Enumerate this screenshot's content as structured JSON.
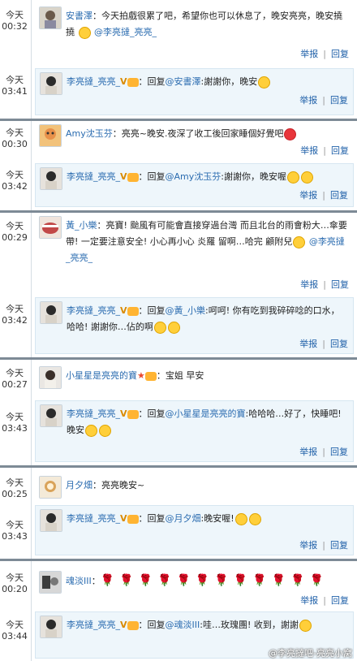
{
  "actions": {
    "report": "举报",
    "reply": "回复"
  },
  "threads": [
    {
      "post": {
        "day": "今天",
        "time": "00:32",
        "user": "安書澤",
        "text": "：今天拍戲很累了吧，希望你也可以休息了，晚安亮亮，晚安撓撓",
        "mention": "@李亮撻_亮亮_"
      },
      "reply": {
        "day": "今天",
        "time": "03:41",
        "user": "李亮撻_亮亮_",
        "prefix": "：回复",
        "mention": "@安書澤",
        "text": ":謝謝你，晚安"
      }
    },
    {
      "post": {
        "day": "今天",
        "time": "00:30",
        "user": "Amy沈玉芬",
        "text": "：亮亮~晚安.夜深了收工後回家睡個好覺吧"
      },
      "reply": {
        "day": "今天",
        "time": "03:42",
        "user": "李亮撻_亮亮_",
        "prefix": "：回复",
        "mention": "@Amy沈玉芬",
        "text": ":謝謝你，晚安喔"
      }
    },
    {
      "post": {
        "day": "今天",
        "time": "00:29",
        "user": "黃_小樂",
        "text": "：亮寶! 颱風有可能會直接穿過台灣  而且北台的雨會粉大…傘要帶! 一定要注意安全! 小心再小心  炎羅  留啊…哈完 顧附兒",
        "mention": "@李亮撻_亮亮_"
      },
      "reply": {
        "day": "今天",
        "time": "03:42",
        "user": "李亮撻_亮亮_",
        "prefix": "：回复",
        "mention": "@黃_小樂",
        "text": ":呵呵! 你有吃到我碎碎唸的口水，哈哈! 謝謝你…佔的啊"
      }
    },
    {
      "post": {
        "day": "今天",
        "time": "00:27",
        "user": "小星星是亮亮的寶",
        "text": "：宝姐 早安"
      },
      "reply": {
        "day": "今天",
        "time": "03:43",
        "user": "李亮撻_亮亮_",
        "prefix": "：回复",
        "mention": "@小星星是亮亮的寶",
        "text": ":哈哈哈…好了，快睡吧! 晚安"
      }
    },
    {
      "post": {
        "day": "今天",
        "time": "00:25",
        "user": "月夕畑",
        "text": "：亮亮晚安~"
      },
      "reply": {
        "day": "今天",
        "time": "03:43",
        "user": "李亮撻_亮亮_",
        "prefix": "：回复",
        "mention": "@月夕畑",
        "text": ":晚安喔!"
      }
    },
    {
      "post": {
        "day": "今天",
        "time": "00:20",
        "user": "魂淡III",
        "text": "："
      },
      "reply": {
        "day": "今天",
        "time": "03:44",
        "user": "李亮撻_亮亮_",
        "prefix": "：回复",
        "mention": "@魂淡III",
        "text": ":哇…玫瑰團! 收到，謝謝"
      }
    }
  ],
  "vbadge": "V",
  "roses": [
    "🌹",
    "🌹",
    "🌹",
    "🌹",
    "🌹",
    "🌹",
    "🌹",
    "🌹",
    "🌹",
    "🌹",
    "🌹",
    "🌹"
  ],
  "watermark": "@李亮撻吧-亮亮小窝"
}
